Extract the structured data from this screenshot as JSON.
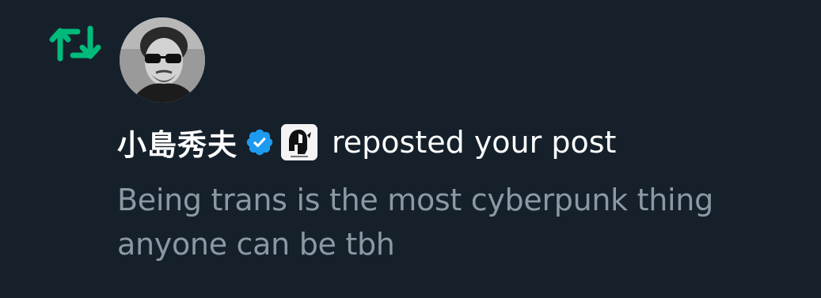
{
  "notification": {
    "type_icon": "repost-icon",
    "actor": {
      "avatar_icon": "avatar-photo",
      "display_name": "小島秀夫",
      "verified_badge_icon": "verified-badge-icon",
      "verified_color": "#1d9bf0",
      "affiliate_badge_icon": "spartan-helmet-logo-icon"
    },
    "action_text": "reposted your post",
    "post_text": "Being trans is the most cyberpunk thing anyone can be tbh"
  },
  "colors": {
    "background": "#15202b",
    "repost_green": "#00ba7c",
    "primary_text": "#ffffff",
    "secondary_text": "#8b98a5"
  }
}
